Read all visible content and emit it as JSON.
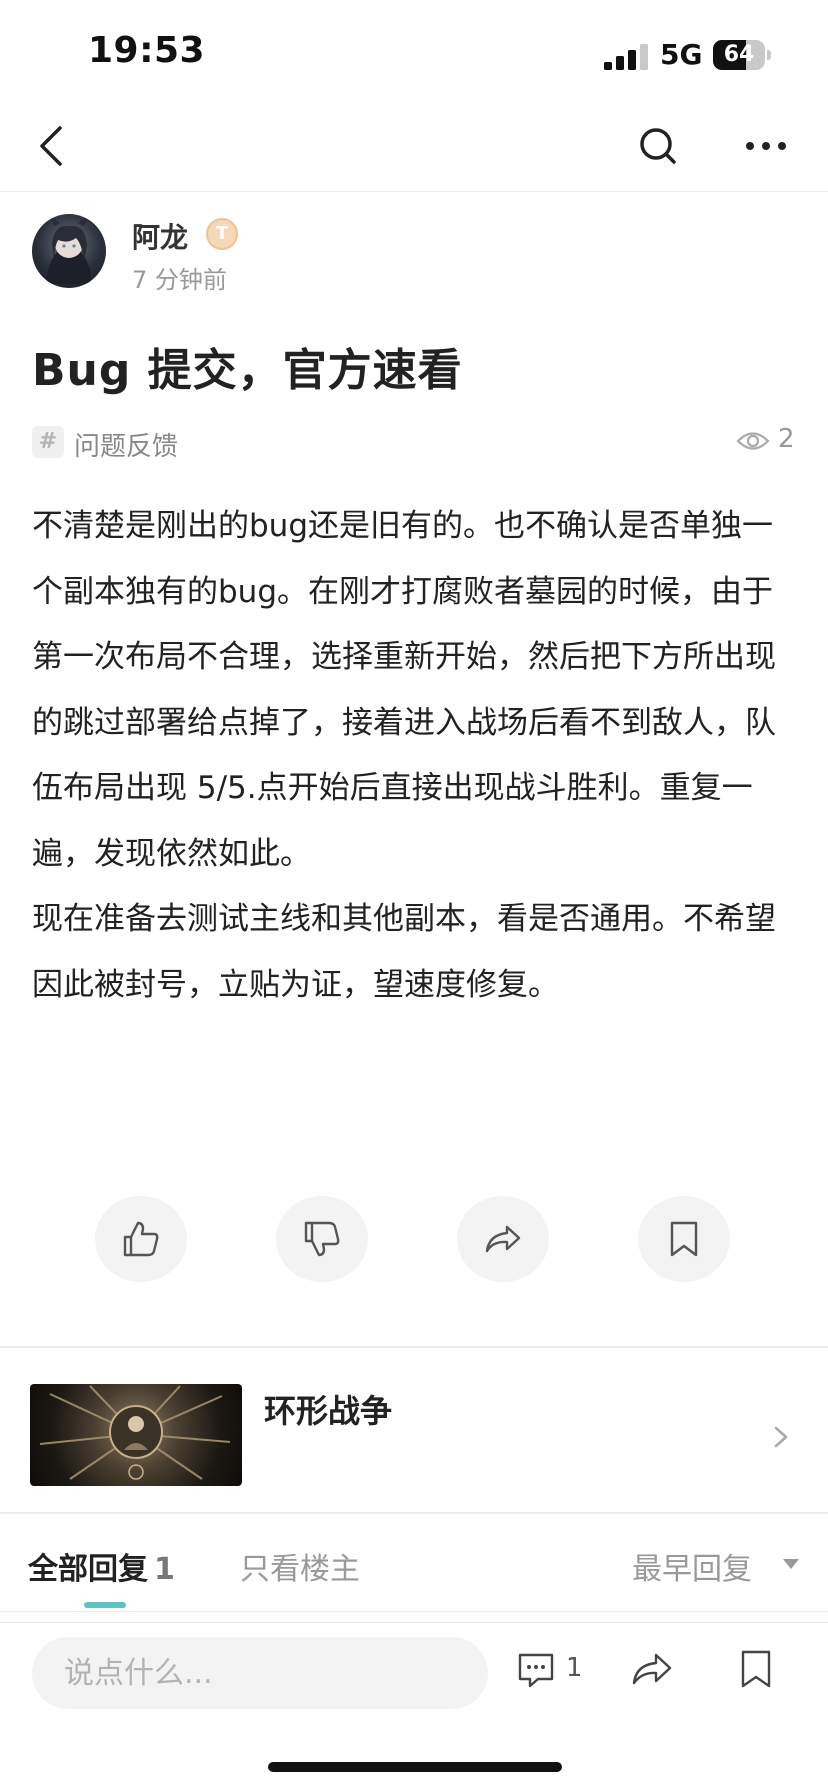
{
  "status_bar": {
    "time": "19:53",
    "network": "5G",
    "battery": "64",
    "battery_level": 0.64
  },
  "author": {
    "name": "阿龙",
    "badge": "T",
    "time_ago": "7 分钟前"
  },
  "post": {
    "title": "Bug 提交，官方速看",
    "tag": "问题反馈",
    "views": "2",
    "paragraphs": [
      "不清楚是刚出的bug还是旧有的。也不确认是否单独一个副本独有的bug。在刚才打腐败者墓园的时候，由于第一次布局不合理，选择重新开始，然后把下方所出现的跳过部署给点掉了，接着进入战场后看不到敌人，队伍布局出现 5/5.点开始后直接出现战斗胜利。重复一遍，发现依然如此。",
      "现在准备去测试主线和其他副本，看是否通用。不希望因此被封号，立贴为证，望速度修复。"
    ]
  },
  "actions": [
    "thumbs-up-icon",
    "thumbs-down-icon",
    "share-icon",
    "bookmark-icon"
  ],
  "game": {
    "name": "环形战争"
  },
  "replies": {
    "all_label": "全部回复",
    "count": "1",
    "op_only_label": "只看楼主",
    "sort_label": "最早回复"
  },
  "bottom_bar": {
    "placeholder": "说点什么...",
    "comment_count": "1"
  },
  "colors": {
    "accent": "#5bc3c8",
    "text": "#222222",
    "muted": "#999999"
  }
}
